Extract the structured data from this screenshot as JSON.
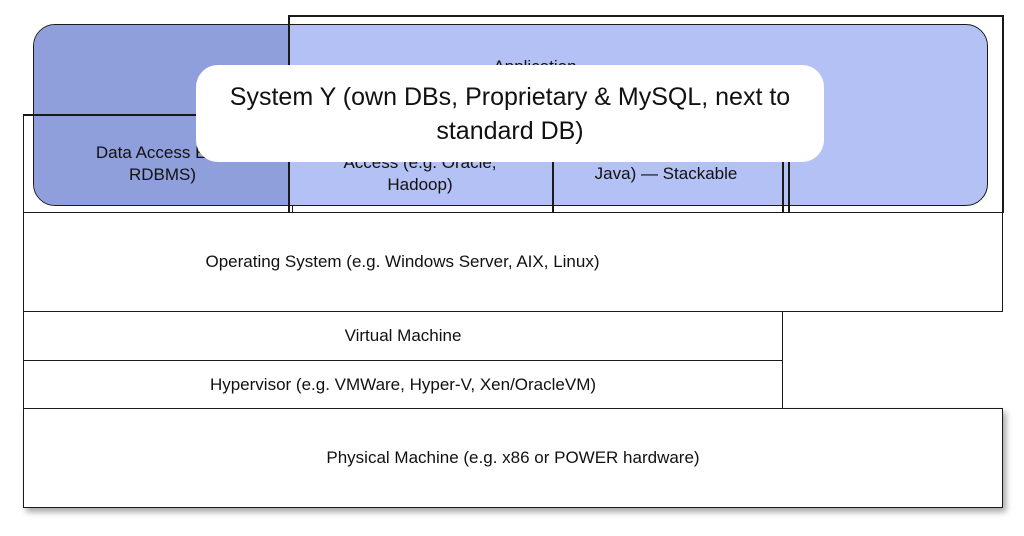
{
  "colors": {
    "panel_light": "#b4c1f4",
    "panel_dark": "#8f9fdb",
    "border": "#1a1a1a",
    "background": "#ffffff"
  },
  "layers": {
    "application": "Application",
    "data_access_engine": "Data Access Engi\nRDBMS)",
    "access_oracle_hadoop": "Access (e.g. Oracle,\nHadoop)",
    "java_stackable": "Java) — Stackable",
    "operating_system": "Operating System (e.g. Windows Server, AIX, Linux)",
    "virtual_machine": "Virtual Machine",
    "hypervisor": "Hypervisor (e.g. VMWare, Hyper-V, Xen/OracleVM)",
    "physical_machine": "Physical Machine (e.g. x86 or POWER hardware)"
  },
  "callout": {
    "text": "System Y (own DBs, Proprietary & MySQL, next to standard DB)"
  }
}
